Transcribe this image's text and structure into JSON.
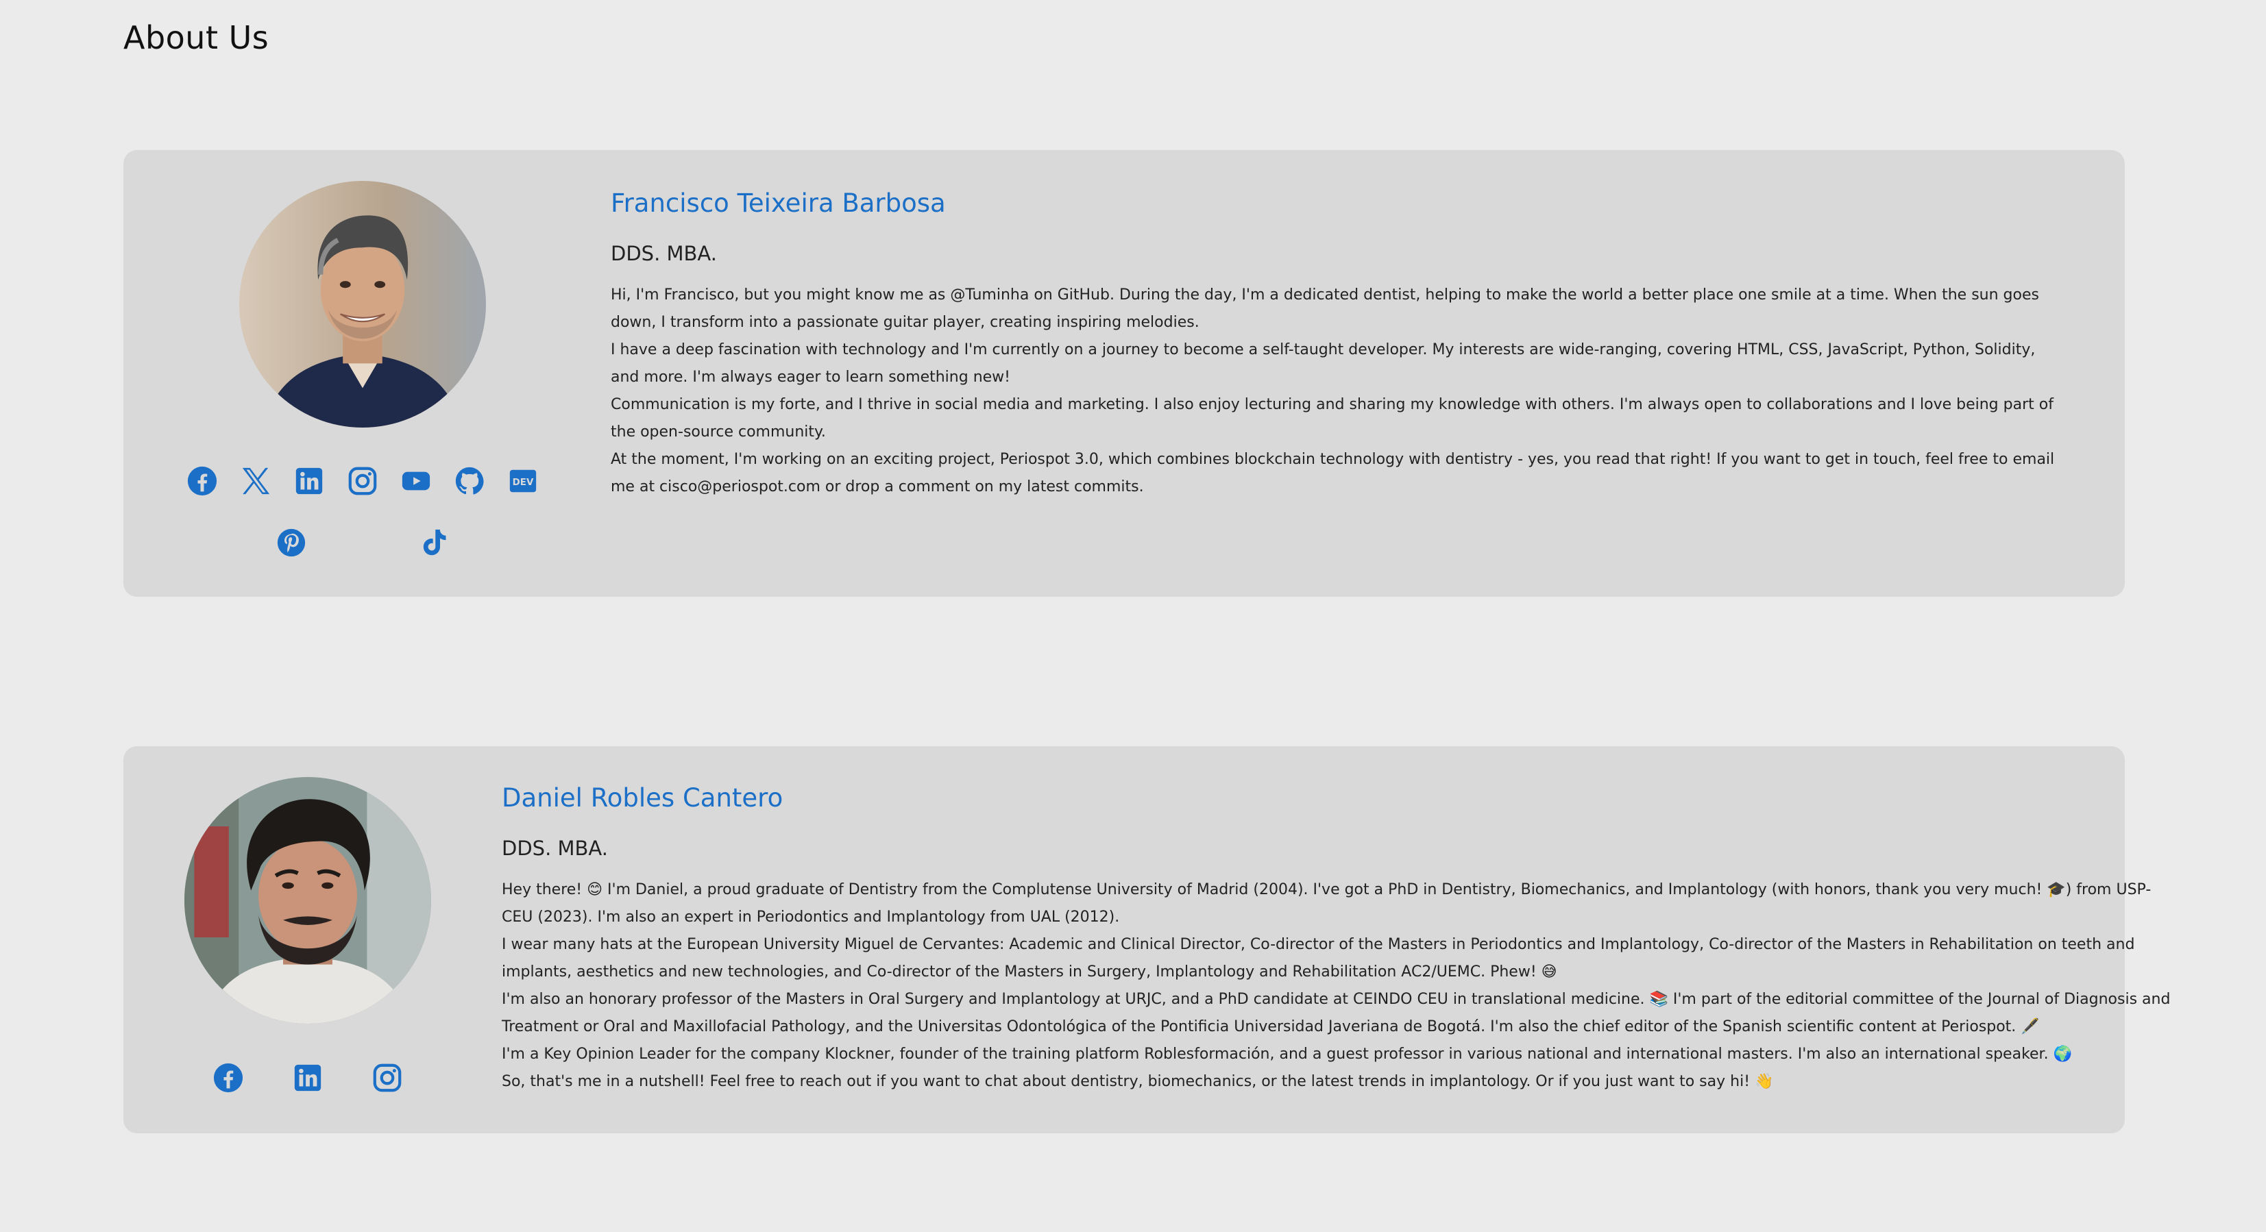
{
  "page": {
    "title": "About Us"
  },
  "colors": {
    "background": "#ebebeb",
    "card": "#d9d9d9",
    "accent": "#1b6fc7",
    "text": "#222222"
  },
  "members": [
    {
      "name": "Francisco Teixeira Barbosa",
      "degree": "DDS. MBA.",
      "bio": [
        "Hi, I'm Francisco, but you might know me as @Tuminha on GitHub. During the day, I'm a dedicated dentist, helping to make the world a better place one smile at a time. When the sun goes down, I transform into a passionate guitar player, creating inspiring melodies.",
        "I have a deep fascination with technology and I'm currently on a journey to become a self-taught developer. My interests are wide-ranging, covering HTML, CSS, JavaScript, Python, Solidity, and more. I'm always eager to learn something new!",
        "Communication is my forte, and I thrive in social media and marketing. I also enjoy lecturing and sharing my knowledge with others. I'm always open to collaborations and I love being part of the open-source community.",
        "At the moment, I'm working on an exciting project, Periospot 3.0, which combines blockchain technology with dentistry - yes, you read that right! If you want to get in touch, feel free to email me at cisco@periospot.com or drop a comment on my latest commits."
      ],
      "social_icons": [
        "facebook-icon",
        "x-icon",
        "linkedin-icon",
        "instagram-icon",
        "youtube-icon",
        "github-icon",
        "dev-icon",
        "pinterest-icon",
        "tiktok-icon"
      ]
    },
    {
      "name": "Daniel Robles Cantero",
      "degree": "DDS. MBA.",
      "bio": [
        "Hey there! 😊 I'm Daniel, a proud graduate of Dentistry from the Complutense University of Madrid (2004). I've got a PhD in Dentistry, Biomechanics, and Implantology (with honors, thank you very much! 🎓) from USP-CEU (2023). I'm also an expert in Periodontics and Implantology from UAL (2012).",
        "I wear many hats at the European University Miguel de Cervantes: Academic and Clinical Director, Co-director of the Masters in Periodontics and Implantology, Co-director of the Masters in Rehabilitation on teeth and implants, aesthetics and new technologies, and Co-director of the Masters in Surgery, Implantology and Rehabilitation AC2/UEMC. Phew! 😅",
        "I'm also an honorary professor of the Masters in Oral Surgery and Implantology at URJC, and a PhD candidate at CEINDO CEU in translational medicine. 📚 I'm part of the editorial committee of the Journal of Diagnosis and Treatment or Oral and Maxillofacial Pathology, and the Universitas Odontológica of the Pontificia Universidad Javeriana de Bogotá. I'm also the chief editor of the Spanish scientific content at Periospot. 🖋️",
        "I'm a Key Opinion Leader for the company Klockner, founder of the training platform Roblesformación, and a guest professor in various national and international masters. I'm also an international speaker. 🌍",
        "So, that's me in a nutshell! Feel free to reach out if you want to chat about dentistry, biomechanics, or the latest trends in implantology. Or if you just want to say hi! 👋"
      ],
      "social_icons": [
        "facebook-icon",
        "linkedin-icon",
        "instagram-icon"
      ]
    }
  ]
}
